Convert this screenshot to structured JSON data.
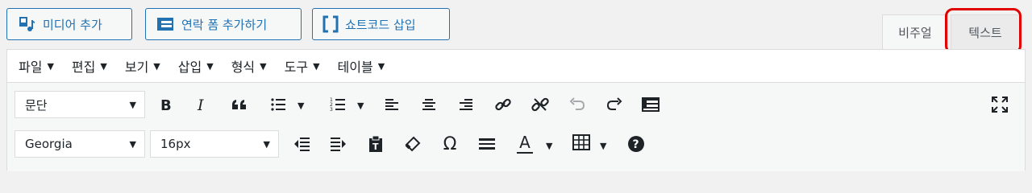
{
  "media_buttons": {
    "add_media": "미디어 추가",
    "add_contact_form": "연락 폼 추가하기",
    "insert_shortcode": "쇼트코드 삽입"
  },
  "tabs": {
    "visual": "비주얼",
    "text": "텍스트"
  },
  "menubar": [
    {
      "label": "파일"
    },
    {
      "label": "편집"
    },
    {
      "label": "보기"
    },
    {
      "label": "삽입"
    },
    {
      "label": "형식"
    },
    {
      "label": "도구"
    },
    {
      "label": "테이블"
    }
  ],
  "toolbar": {
    "format_select": "문단",
    "font_family_select": "Georgia",
    "font_size_select": "16px",
    "omega_glyph": "Ω",
    "text_color_glyph": "A"
  },
  "colors": {
    "accent": "#2271b1",
    "highlight": "#e00000"
  }
}
